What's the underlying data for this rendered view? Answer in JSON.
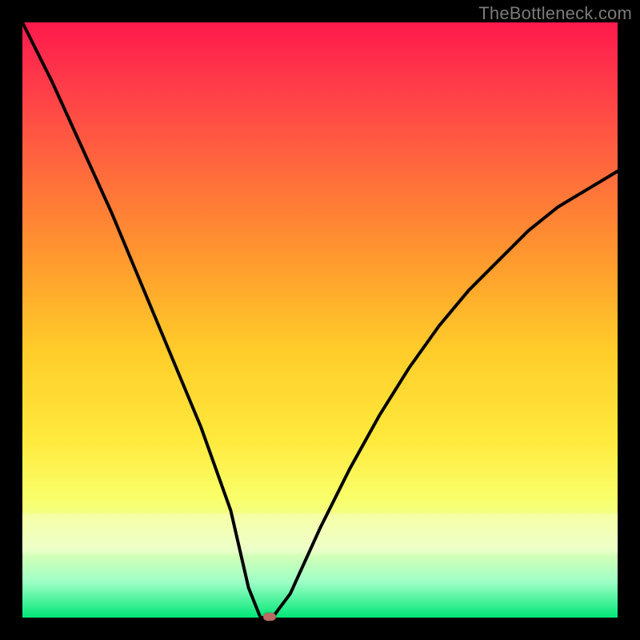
{
  "watermark": "TheBottleneck.com",
  "chart_data": {
    "type": "line",
    "title": "",
    "xlabel": "",
    "ylabel": "",
    "xlim": [
      0,
      100
    ],
    "ylim": [
      0,
      100
    ],
    "x": [
      0,
      5,
      10,
      15,
      20,
      25,
      30,
      35,
      38,
      40,
      42,
      45,
      50,
      55,
      60,
      65,
      70,
      75,
      80,
      85,
      90,
      95,
      100
    ],
    "values": [
      100,
      90,
      79,
      68,
      56,
      44,
      32,
      18,
      5,
      0,
      0,
      4,
      15,
      25,
      34,
      42,
      49,
      55,
      60,
      65,
      69,
      72,
      75
    ],
    "minimum_x": 41,
    "marker": {
      "x": 41.5,
      "y": 0
    }
  },
  "colors": {
    "curve": "#000000",
    "marker": "#b86a65",
    "frame": "#000000"
  }
}
